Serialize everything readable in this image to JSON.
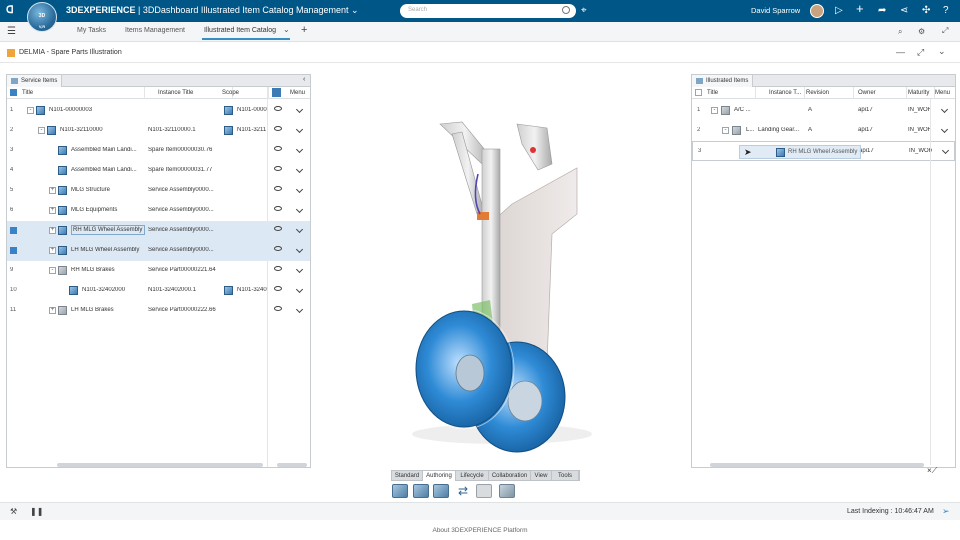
{
  "topbar": {
    "brand_bold": "3DEXPERIENCE",
    "brand_rest": " | 3DDashboard  Illustrated Item Catalog Management",
    "search_placeholder": "Search",
    "user_name": "David Sparrow",
    "compass_top": "3D",
    "compass_bottom": "V,R"
  },
  "tabs": [
    "My Tasks",
    "Items Management",
    "Illustrated Item Catalog"
  ],
  "app": {
    "title": "DELMIA - Spare Parts Illustration"
  },
  "left_panel": {
    "tab_label": "Service Items",
    "columns": [
      "Title",
      "Instance Title",
      "Scope",
      "Menu"
    ],
    "rows": [
      {
        "num": "1",
        "title": "N101-00000003",
        "instance": "",
        "scope": "N101-0000",
        "level": 0,
        "toggle": "-",
        "icon": "cube",
        "checked": false,
        "selected": false
      },
      {
        "num": "2",
        "title": "N101-32110000",
        "instance": "N101-32110000.1",
        "scope": "N101-3211",
        "level": 1,
        "toggle": "-",
        "icon": "cube",
        "checked": false,
        "selected": false
      },
      {
        "num": "3",
        "title": "Assembled Main Landi...",
        "instance": "Spare Item00000030.76",
        "scope": "",
        "level": 2,
        "toggle": "",
        "icon": "cube",
        "checked": false,
        "selected": false
      },
      {
        "num": "4",
        "title": "Assembled Main Landi...",
        "instance": "Spare Item00000031.77",
        "scope": "",
        "level": 2,
        "toggle": "",
        "icon": "cube",
        "checked": false,
        "selected": false
      },
      {
        "num": "5",
        "title": "MLG Structure",
        "instance": "Service Assembly0000...",
        "scope": "",
        "level": 2,
        "toggle": "+",
        "icon": "cube",
        "checked": false,
        "selected": false
      },
      {
        "num": "6",
        "title": "MLG Equipments",
        "instance": "Service Assembly0000...",
        "scope": "",
        "level": 2,
        "toggle": "+",
        "icon": "cube",
        "checked": false,
        "selected": false
      },
      {
        "num": "7",
        "title": "RH MLG Wheel Assembly",
        "instance": "Service Assembly0000...",
        "scope": "",
        "level": 2,
        "toggle": "+",
        "icon": "cube",
        "checked": true,
        "selected": true
      },
      {
        "num": "8",
        "title": "LH MLG Wheel Assembly",
        "instance": "Service Assembly0000...",
        "scope": "",
        "level": 2,
        "toggle": "+",
        "icon": "cube",
        "checked": true,
        "selected": true
      },
      {
        "num": "9",
        "title": "RH MLG Brakes",
        "instance": "Service Part00000221.64",
        "scope": "",
        "level": 2,
        "toggle": "-",
        "icon": "cubeg",
        "checked": false,
        "selected": false
      },
      {
        "num": "10",
        "title": "N101-32402000",
        "instance": "N101-32402000.1",
        "scope": "N101-3240",
        "level": 3,
        "toggle": "",
        "icon": "cube",
        "checked": false,
        "selected": false
      },
      {
        "num": "11",
        "title": "LH MLG Brakes",
        "instance": "Service Part00000222.66",
        "scope": "",
        "level": 2,
        "toggle": "+",
        "icon": "cubeg",
        "checked": false,
        "selected": false
      }
    ]
  },
  "right_panel": {
    "tab_label": "Illustrated Items",
    "columns": [
      "Title",
      "Instance T...",
      "Revision",
      "Owner",
      "Maturity",
      "Menu"
    ],
    "rows": [
      {
        "num": "1",
        "title": "A/C ...",
        "instance": "",
        "revision": "A",
        "owner": "api17",
        "maturity": "IN_WOR"
      },
      {
        "num": "2",
        "title": "L...",
        "instance": "Landing Gear...",
        "revision": "A",
        "owner": "api17",
        "maturity": "IN_WOR"
      },
      {
        "num": "3",
        "title": "",
        "instance": "",
        "revision": "",
        "owner": "api17",
        "maturity": "IN_WOR"
      }
    ],
    "drag_label": "RH MLG Wheel Assembly"
  },
  "action_bar": {
    "tabs": [
      "Standard",
      "Authoring",
      "Lifecycle",
      "Collaboration",
      "View",
      "Tools"
    ],
    "active": "Authoring"
  },
  "status": {
    "indexing": "Last Indexing : 10:46:47 AM"
  },
  "footer": {
    "text": "About 3DEXPERIENCE Platform"
  },
  "colors": {
    "topbar": "#005686",
    "selection": "#dce8f3",
    "wheel": "#2f8bd6",
    "accent": "#368ec4"
  }
}
